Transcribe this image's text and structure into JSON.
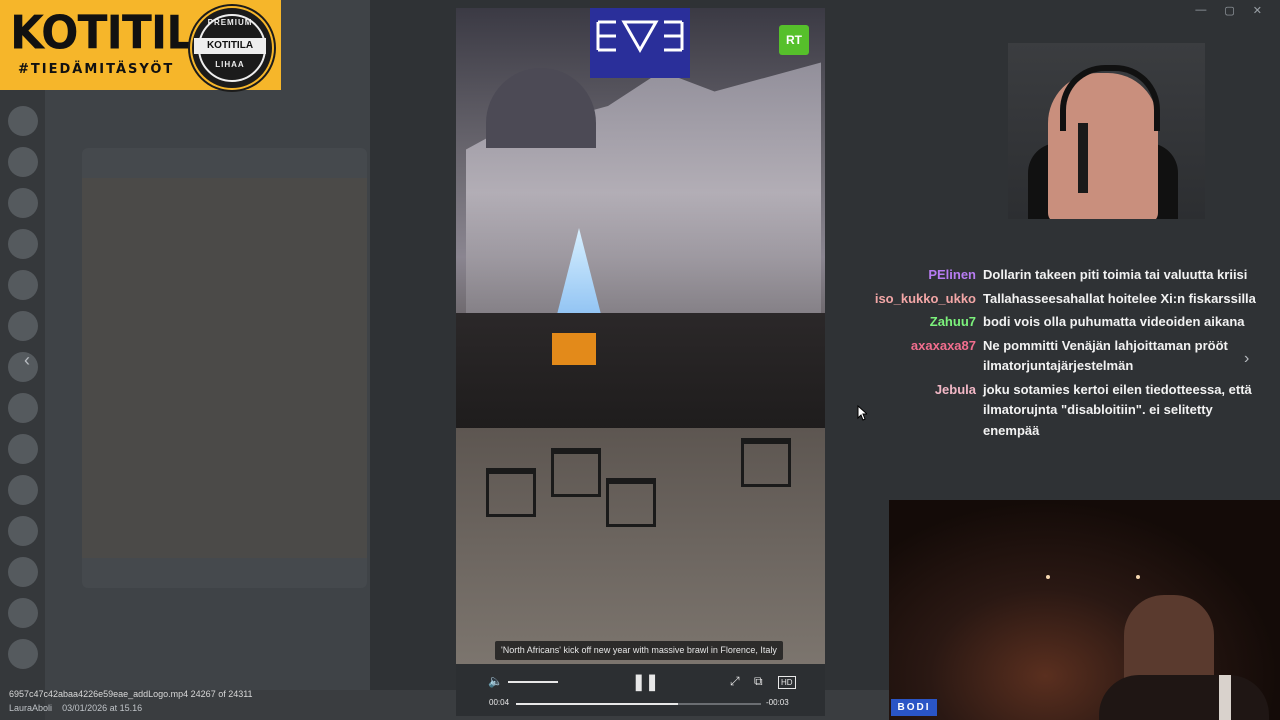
{
  "logo": {
    "title": "KOTITILA",
    "tagline": "#TIEDÄMITÄSYÖT",
    "seal_top": "PREMIUM",
    "seal_middle": "KOTITILA",
    "seal_bottom": "LIHAA"
  },
  "video": {
    "overlay_logo_left": "LEVEL",
    "overlay_logo_right": "RT",
    "caption": "'North Africans' kick off new year with massive brawl in Florence, Italy",
    "current_time": "00:04",
    "remaining_time": "-00:03",
    "progress": 0.66
  },
  "file": {
    "name_line": "6957c47c42abaa4226e59eae_addLogo.mp4 24267 of 24311",
    "author": "LauraAboli",
    "date": "03/01/2026 at 15.16"
  },
  "chat": {
    "messages": [
      {
        "user": "PElinen",
        "color": "#b77cf2",
        "text": "Dollarin takeen piti toimia tai valuutta kriisi"
      },
      {
        "user": "iso_kukko_ukko",
        "color": "#f2a6a6",
        "text": "Tallahasseesahallat hoitelee Xi:n fiskarssilla"
      },
      {
        "user": "Zahuu7",
        "color": "#7cf27c",
        "text": "bodi vois olla puhumatta videoiden aikana"
      },
      {
        "user": "axaxaxa87",
        "color": "#f26e8e",
        "text": "Ne pommitti Venäjän lahjoittaman prööt ilmatorjuntajärjestelmän"
      },
      {
        "user": "Jebula",
        "color": "#f2b8c6",
        "text": "joku sotamies kertoi eilen tiedotteessa, että ilmatorujnta \"disabloitiin\". ei selitetty enempää"
      }
    ]
  },
  "camera_label": "BODI",
  "icons": {
    "volume": "volume-icon",
    "pause": "pause-icon",
    "fullscreen": "fullscreen-icon",
    "pip": "picture-in-picture-icon",
    "hd": "hd-icon"
  }
}
